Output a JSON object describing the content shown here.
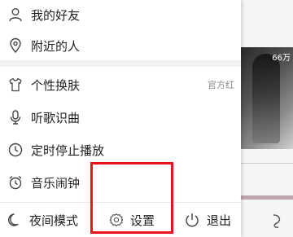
{
  "menu": {
    "friends": {
      "label": "我的好友",
      "icon": "person-icon"
    },
    "nearby": {
      "label": "附近的人",
      "icon": "location-pin-icon"
    },
    "skin": {
      "label": "个性换肤",
      "icon": "tshirt-icon",
      "meta": "官方红"
    },
    "recognize": {
      "label": "听歌识曲",
      "icon": "microphone-icon"
    },
    "timer": {
      "label": "定时停止播放",
      "icon": "clock-icon"
    },
    "alarm": {
      "label": "音乐闹钟",
      "icon": "alarm-clock-icon"
    }
  },
  "bottom_bar": {
    "night_mode": {
      "label": "夜间模式",
      "icon": "moon-icon"
    },
    "settings": {
      "label": "设置",
      "icon": "gear-icon"
    },
    "logout": {
      "label": "退出",
      "icon": "power-icon"
    }
  },
  "background": {
    "play_count": "66万"
  },
  "colors": {
    "highlight": "#e8141c",
    "icon": "#444444"
  }
}
